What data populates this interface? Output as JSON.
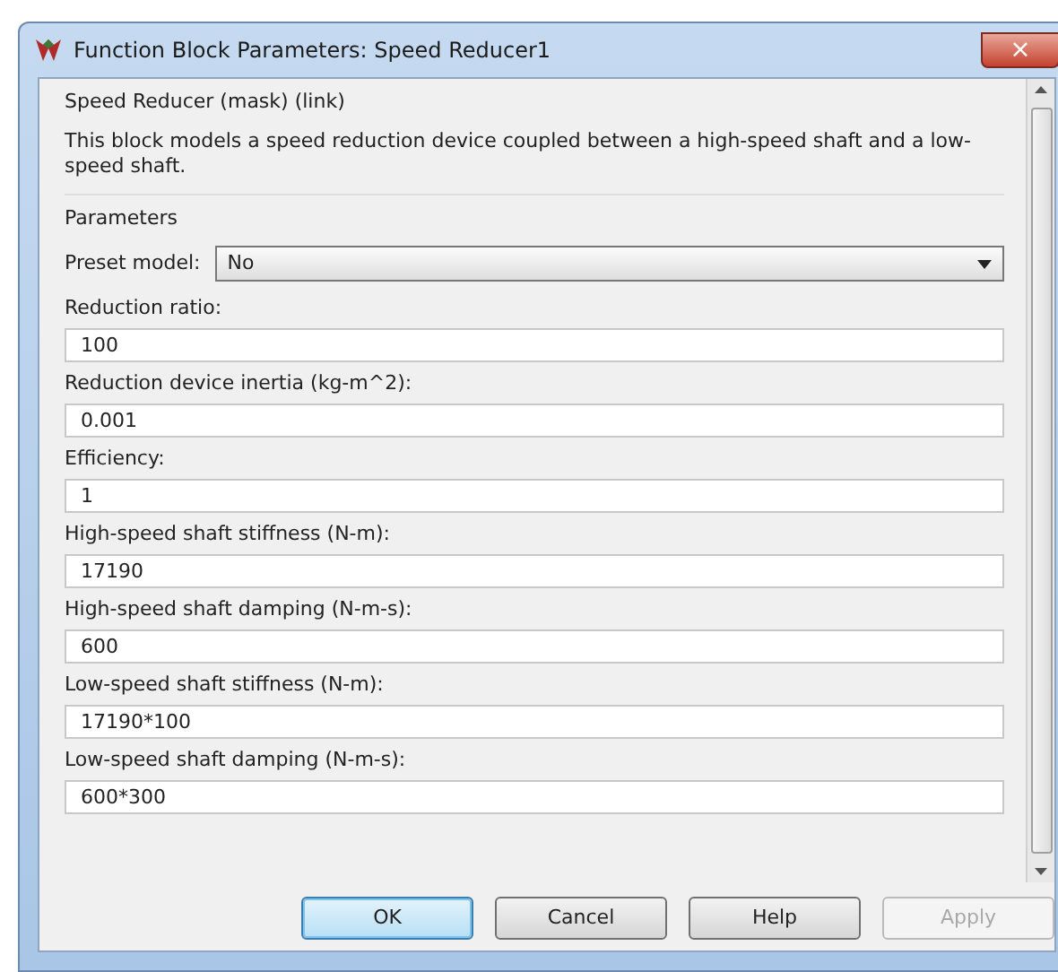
{
  "window": {
    "title": "Function Block Parameters: Speed Reducer1",
    "close": "×"
  },
  "header": "Speed Reducer (mask) (link)",
  "description": "This block models a speed reduction device coupled between a high-speed shaft and a low-speed shaft.",
  "section": "Parameters",
  "preset": {
    "label": "Preset model:",
    "value": "No"
  },
  "parameters": [
    {
      "label": "Reduction ratio:",
      "value": "100"
    },
    {
      "label": "Reduction device inertia (kg-m^2):",
      "value": "0.001"
    },
    {
      "label": "Efficiency:",
      "value": "1"
    },
    {
      "label": "High-speed shaft stiffness (N-m):",
      "value": "17190"
    },
    {
      "label": "High-speed shaft damping (N-m-s):",
      "value": "600"
    },
    {
      "label": "Low-speed shaft stiffness (N-m):",
      "value": "17190*100"
    },
    {
      "label": "Low-speed shaft damping (N-m-s):",
      "value": "600*300"
    }
  ],
  "buttons": [
    {
      "label": "OK",
      "default": true,
      "disabled": false
    },
    {
      "label": "Cancel",
      "default": false,
      "disabled": false
    },
    {
      "label": "Help",
      "default": false,
      "disabled": false
    },
    {
      "label": "Apply",
      "default": false,
      "disabled": true
    }
  ]
}
